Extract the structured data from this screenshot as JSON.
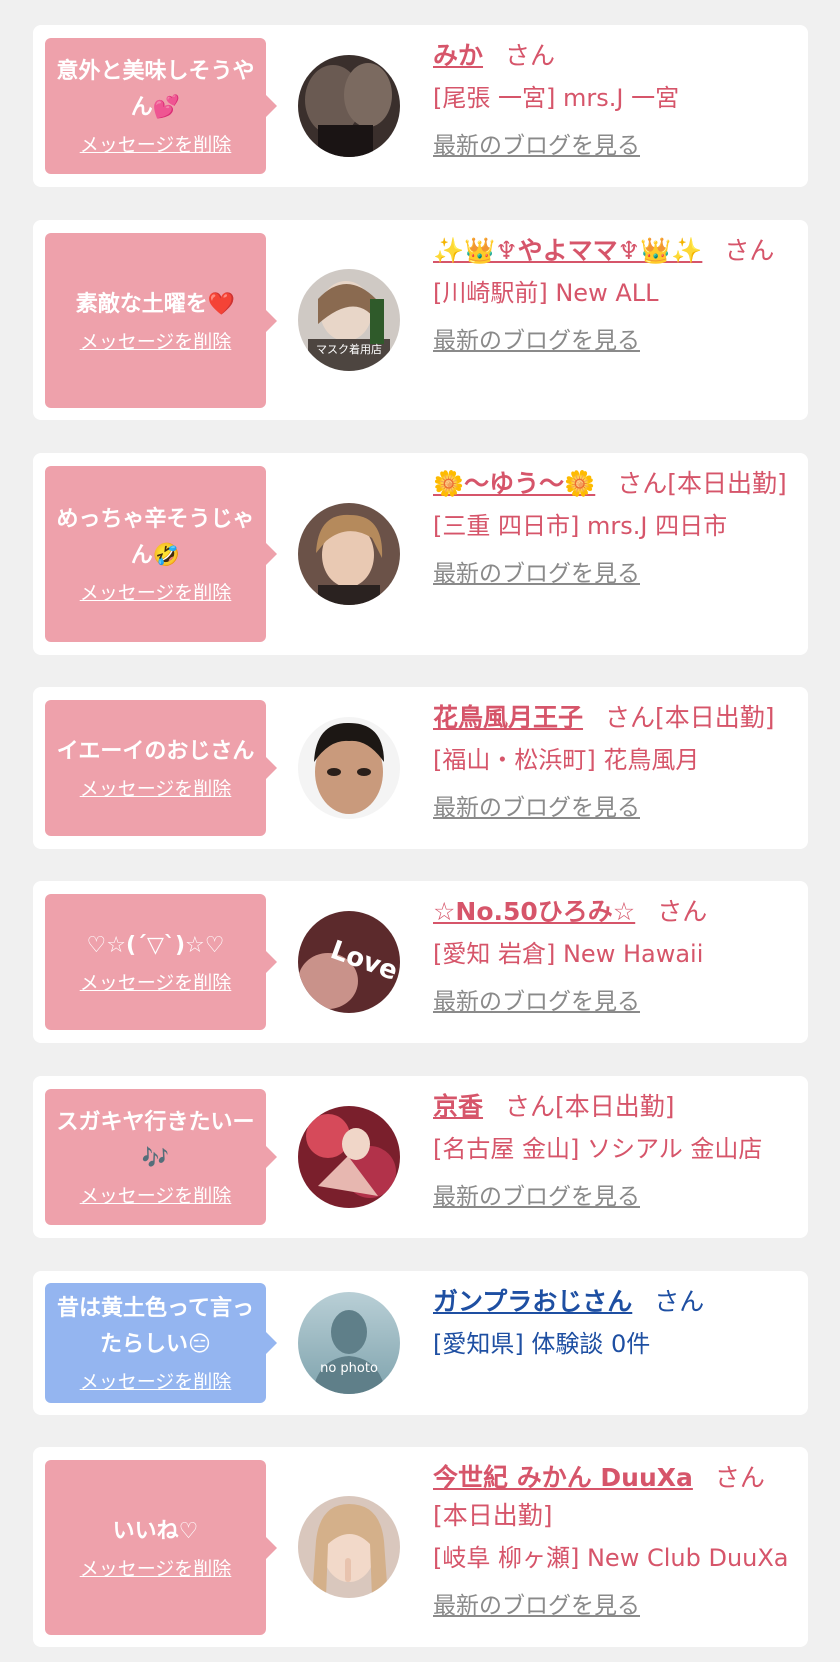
{
  "delete_label": "メッセージを削除",
  "blog_label": "最新のブログを見る",
  "entries": [
    {
      "message": "意外と美味しそうやん💕",
      "name": "みか",
      "suffix": "さん",
      "shop": "[尾張 一宮] mrs.J 一宮"
    },
    {
      "message": "素敵な土曜を❤️",
      "name": "✨👑♆やよママ♆👑✨",
      "suffix": "さん",
      "shop": "[川崎駅前] New ALL",
      "avatar_text": "マスク着用店"
    },
    {
      "message": "めっちゃ辛そうじゃん🤣",
      "name": "🌼〜ゆう〜🌼",
      "suffix": "さん[本日出勤]",
      "shop": "[三重 四日市] mrs.J 四日市"
    },
    {
      "message": "イエーイのおじさん",
      "name": "花鳥風月王子",
      "suffix": "さん[本日出勤]",
      "shop": "[福山・松浜町] 花鳥風月"
    },
    {
      "message": "♡☆(´▽`)☆♡",
      "name": "☆No.50ひろみ☆",
      "suffix": "さん",
      "shop": "[愛知 岩倉] New Hawaii",
      "avatar_text": "Love"
    },
    {
      "message": "スガキヤ行きたいー🎶",
      "name": "京香",
      "suffix": "さん[本日出勤]",
      "shop": "[名古屋 金山] ソシアル 金山店"
    },
    {
      "message": "昔は黄土色って言ったらしい😑",
      "name": "ガンプラおじさん",
      "suffix": "さん",
      "shop": "[愛知県] 体験談 0件",
      "avatar_text": "no photo"
    },
    {
      "message": "いいね♡",
      "name": "今世紀 みかん DuuXa",
      "suffix": "さん[本日出勤]",
      "shop": "[岐阜 柳ヶ瀬] New Club DuuXa"
    }
  ],
  "colors": {
    "pink_bubble": "#eea1ab",
    "blue_bubble": "#94b5f0",
    "name_pink": "#d6556a",
    "name_blue": "#1e4fa2",
    "link_gray": "#8a8a8a"
  }
}
